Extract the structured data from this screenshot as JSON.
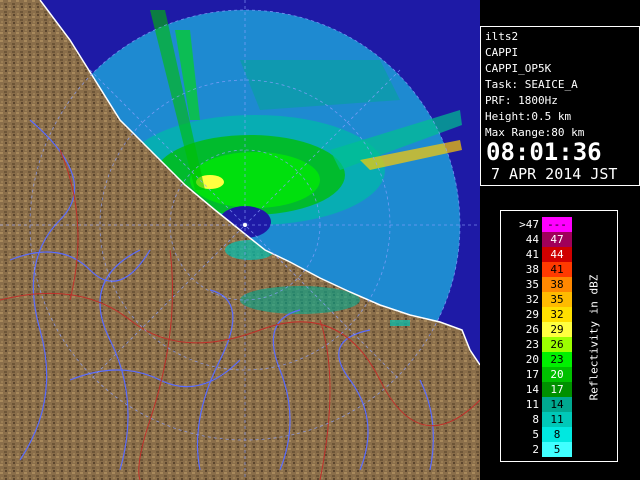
{
  "info": {
    "site": "ilts2",
    "product": "CAPPI",
    "product_code": "CAPPI_OP5K",
    "task": "Task: SEAICE_A",
    "prf": "PRF: 1800Hz",
    "height": "Height:0.5 km",
    "max_range": "Max Range:80 km",
    "time": "08:01:36",
    "date": "7 APR 2014 JST"
  },
  "legend": {
    "title": "Reflectivity in dBZ",
    "rows": [
      {
        "low": ">47",
        "high": "---",
        "color": "#ff00ff"
      },
      {
        "low": "44",
        "high": "47",
        "color": "#a0005a"
      },
      {
        "low": "41",
        "high": "44",
        "color": "#d00000"
      },
      {
        "low": "38",
        "high": "41",
        "color": "#ff3a00"
      },
      {
        "low": "35",
        "high": "38",
        "color": "#ff8800"
      },
      {
        "low": "32",
        "high": "35",
        "color": "#ffbb00"
      },
      {
        "low": "29",
        "high": "32",
        "color": "#ffe000"
      },
      {
        "low": "26",
        "high": "29",
        "color": "#ffff40"
      },
      {
        "low": "23",
        "high": "26",
        "color": "#9cff00"
      },
      {
        "low": "20",
        "high": "23",
        "color": "#00f000"
      },
      {
        "low": "17",
        "high": "20",
        "color": "#00c000"
      },
      {
        "low": "14",
        "high": "17",
        "color": "#009000"
      },
      {
        "low": "11",
        "high": "14",
        "color": "#00a890"
      },
      {
        "low": "8",
        "high": "11",
        "color": "#00c8b8"
      },
      {
        "low": "5",
        "high": "8",
        "color": "#00e8e0"
      },
      {
        "low": "2",
        "high": "5",
        "color": "#40ffff"
      }
    ]
  },
  "map": {
    "land_color": "#8a6e4a",
    "sea_color": "#1e1aa6",
    "coast_color": "#ffffff",
    "river_color": "#5a6cff",
    "border_color": "#c0302a",
    "range_ring_color": "#8aa0ff"
  }
}
